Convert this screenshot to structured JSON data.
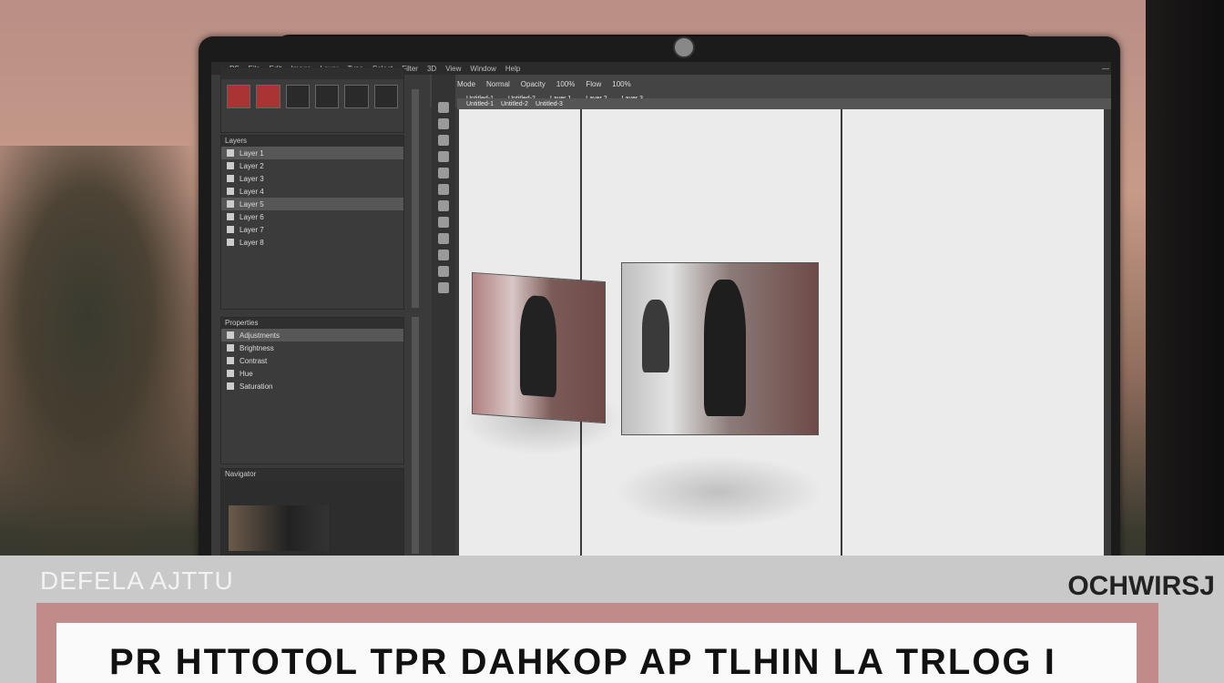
{
  "app": {
    "menu_items": [
      "PS",
      "File",
      "Edit",
      "Image",
      "Layer",
      "Type",
      "Select",
      "Filter",
      "3D",
      "View",
      "Window",
      "Help"
    ],
    "window_controls": [
      "—",
      "□",
      "×"
    ]
  },
  "options_bar": {
    "row1": [
      "Mode",
      "Normal",
      "Opacity",
      "100%",
      "Flow",
      "100%"
    ],
    "row2": [
      "Untitled-1",
      "Untitled-2",
      "Layer 1",
      "Layer 2",
      "Layer 3"
    ]
  },
  "doc_tabs": [
    "Untitled-1",
    "Untitled-2",
    "Untitled-3"
  ],
  "panels": {
    "layers": {
      "title": "Layers",
      "rows": [
        "Layer 1",
        "Layer 2",
        "Layer 3",
        "Layer 4",
        "Layer 5",
        "Layer 6",
        "Layer 7",
        "Layer 8"
      ]
    },
    "properties": {
      "title": "Properties",
      "rows": [
        "Adjustments",
        "Brightness",
        "Contrast",
        "Hue",
        "Saturation"
      ]
    },
    "navigator": {
      "title": "Navigator"
    }
  },
  "banner": {
    "left_title": "DEFELA AJTTU",
    "right_title": "OCHWIRSJ",
    "main_text": "PR HTTOTOL TPR   DAHKOP AP TLHIN LA TRLOG I"
  },
  "colors": {
    "accent_pink": "#c08b88",
    "panel_bg": "#3b3b3c",
    "canvas_bg": "#ebebeb"
  }
}
